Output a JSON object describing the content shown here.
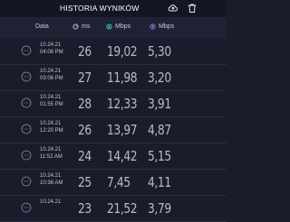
{
  "header": {
    "title": "HISTORIA WYNIKÓW",
    "cloud_icon": "cloud-upload-icon",
    "trash_icon": "trash-icon"
  },
  "columns": {
    "date": "Data",
    "ping": "ms",
    "download": "Mbps",
    "upload": "Mbps",
    "ping_icon": "ping-gauge-icon",
    "download_icon": "download-arrow-icon",
    "upload_icon": "upload-arrow-icon"
  },
  "colors": {
    "background": "#1a1c2b",
    "download_accent": "#4fd1c5",
    "upload_accent": "#b57ee5"
  },
  "rows": [
    {
      "date": "10.24.21",
      "time": "04:08 PM",
      "ping": "26",
      "download": "19,02",
      "upload": "5,30"
    },
    {
      "date": "10.24.21",
      "time": "03:06 PM",
      "ping": "27",
      "download": "11,98",
      "upload": "3,20"
    },
    {
      "date": "10.24.21",
      "time": "01:55 PM",
      "ping": "28",
      "download": "12,33",
      "upload": "3,91"
    },
    {
      "date": "10.24.21",
      "time": "12:20 PM",
      "ping": "26",
      "download": "13,97",
      "upload": "4,87"
    },
    {
      "date": "10.24.21",
      "time": "11:52 AM",
      "ping": "24",
      "download": "14,42",
      "upload": "5,15"
    },
    {
      "date": "10.24.21",
      "time": "10:38 AM",
      "ping": "25",
      "download": "7,45",
      "upload": "4,11"
    },
    {
      "date": "10.24.21",
      "time": "",
      "ping": "23",
      "download": "21,52",
      "upload": "3,79"
    }
  ]
}
